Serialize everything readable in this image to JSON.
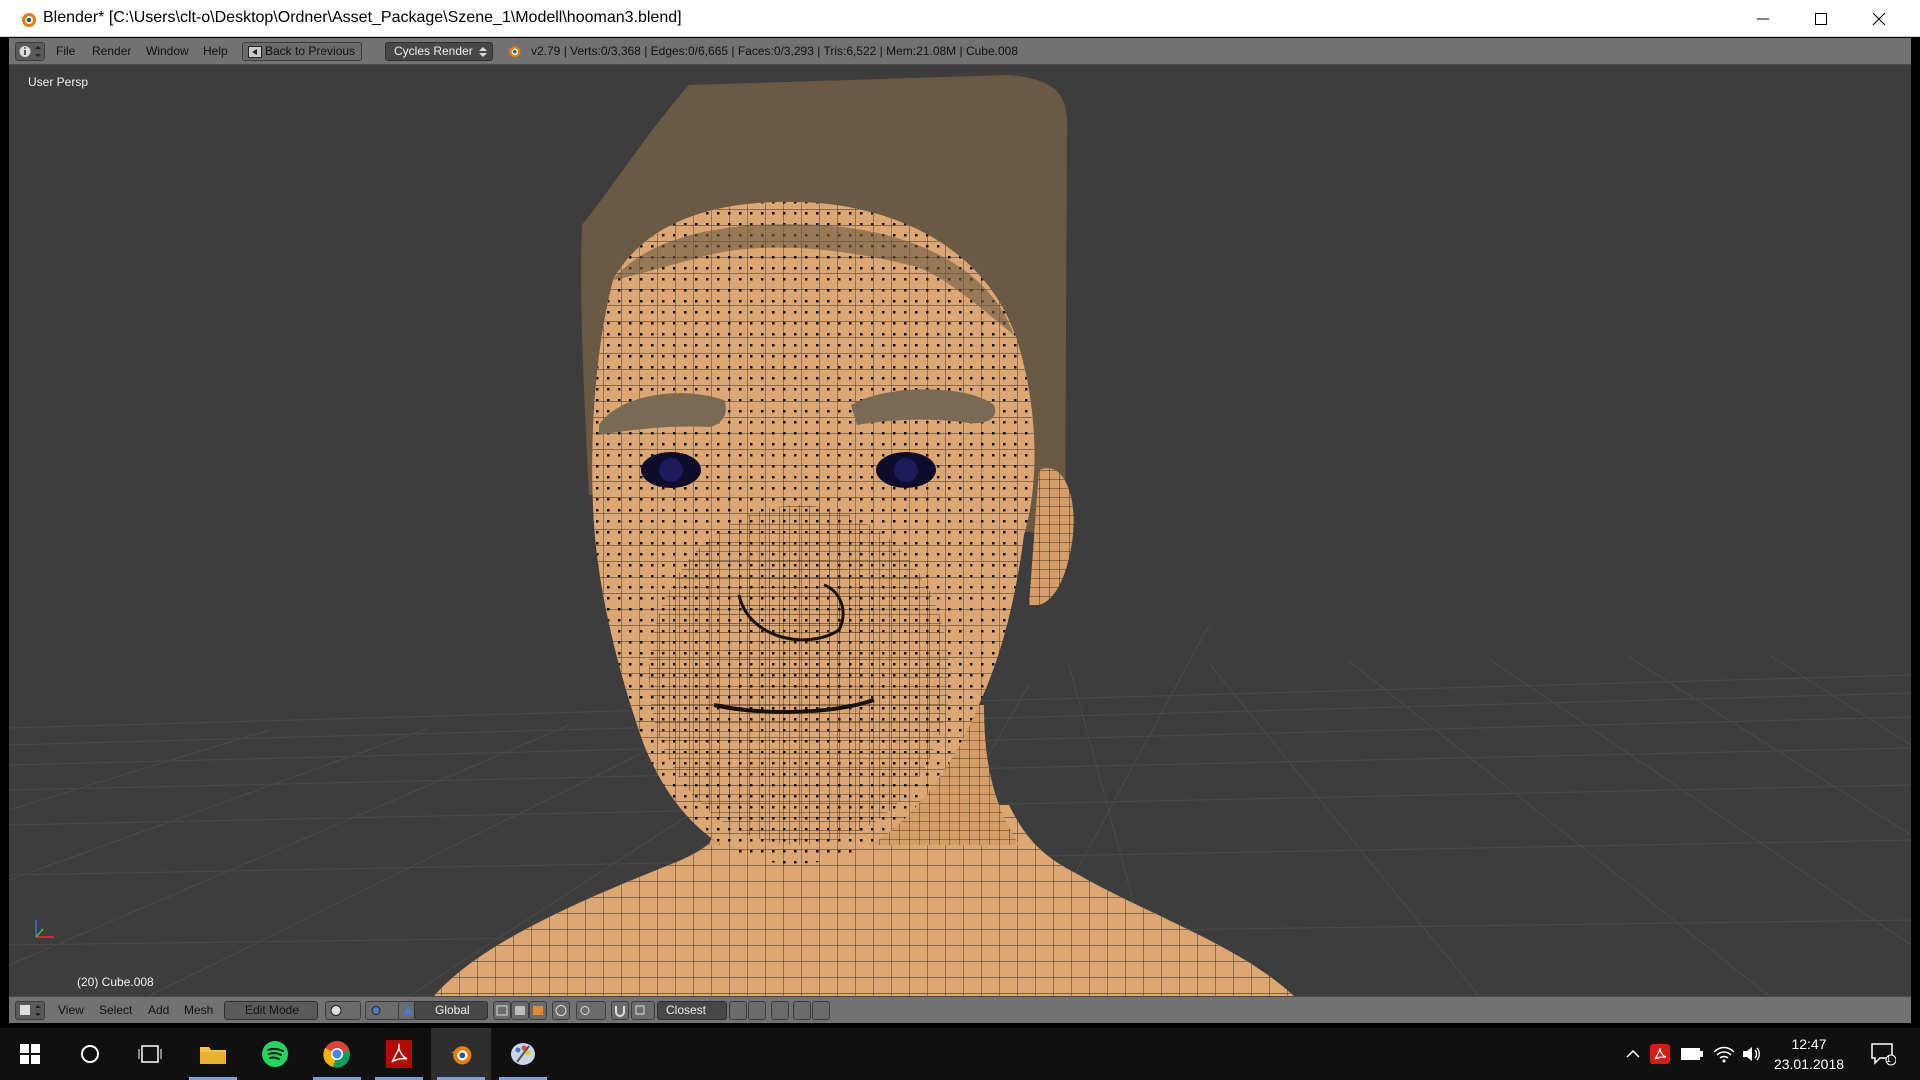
{
  "window": {
    "title": "Blender* [C:\\Users\\clt-o\\Desktop\\Ordner\\Asset_Package\\Szene_1\\Modell\\hooman3.blend]"
  },
  "info_header": {
    "menus": [
      "File",
      "Render",
      "Window",
      "Help"
    ],
    "back_button": "Back to Previous",
    "render_engine": "Cycles Render",
    "stats": "v2.79 | Verts:0/3,368 | Edges:0/6,665 | Faces:0/3,293 | Tris:6,522 | Mem:21.08M | Cube.008"
  },
  "viewport": {
    "view_name": "User Persp",
    "object_label": "(20) Cube.008"
  },
  "view_header": {
    "menus": [
      "View",
      "Select",
      "Add",
      "Mesh"
    ],
    "mode": "Edit Mode",
    "orientation": "Global",
    "snap_target": "Closest"
  },
  "taskbar": {
    "time": "12:47",
    "date": "23.01.2018",
    "notification_count": "1"
  },
  "colors": {
    "viewport_bg": "#3d3d3d",
    "skin": "#dca772",
    "hair": "#6a5a44",
    "header_bg": "#727272"
  }
}
